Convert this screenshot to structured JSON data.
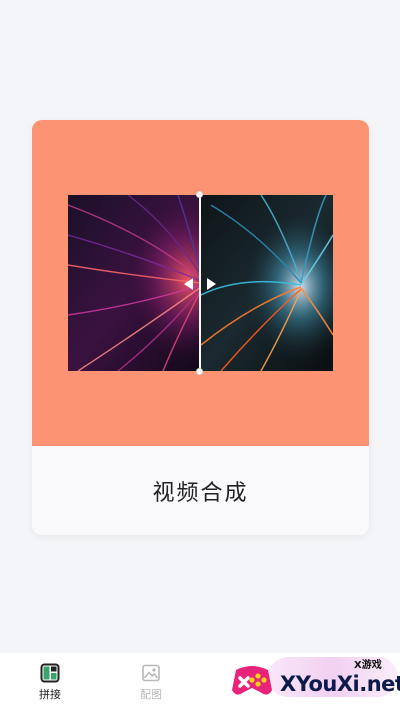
{
  "feature_card": {
    "title": "视频合成"
  },
  "bottom_nav": {
    "items": [
      {
        "label": "拼接",
        "icon": "splice-icon",
        "active": true
      },
      {
        "label": "配图",
        "icon": "image-icon",
        "active": false
      }
    ]
  },
  "watermark": {
    "small_text": "X游戏",
    "big_text": "XYouXi.net"
  },
  "colors": {
    "card_accent": "#fc9474",
    "page_background": "#f4f5f8",
    "active_label": "#222222",
    "inactive_label": "#b8b8b8",
    "splice_icon_green": "#3aa56b"
  }
}
